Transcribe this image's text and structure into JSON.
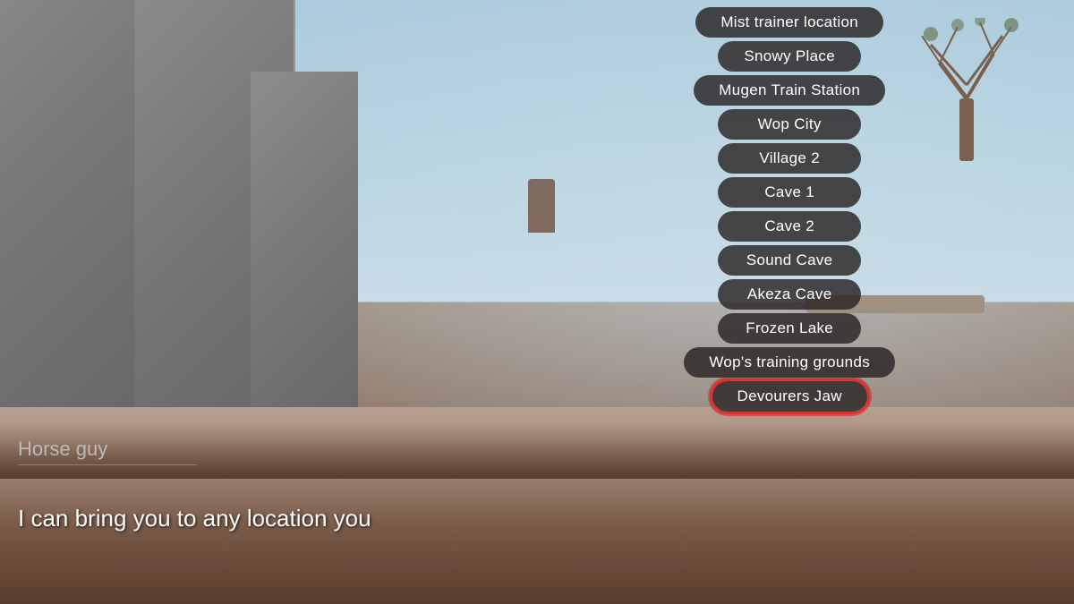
{
  "scene": {
    "npc_name": "Horse guy",
    "npc_dialogue": "I can bring you to any location you"
  },
  "location_menu": {
    "items": [
      {
        "id": "mist-trainer-location",
        "label": "Mist trainer location",
        "selected": false
      },
      {
        "id": "snowy-place",
        "label": "Snowy Place",
        "selected": false
      },
      {
        "id": "mugen-train-station",
        "label": "Mugen Train Station",
        "selected": false
      },
      {
        "id": "wop-city",
        "label": "Wop City",
        "selected": false
      },
      {
        "id": "village-2",
        "label": "Village 2",
        "selected": false
      },
      {
        "id": "cave-1",
        "label": "Cave 1",
        "selected": false
      },
      {
        "id": "cave-2",
        "label": "Cave 2",
        "selected": false
      },
      {
        "id": "sound-cave",
        "label": "Sound Cave",
        "selected": false
      },
      {
        "id": "akeza-cave",
        "label": "Akeza Cave",
        "selected": false
      },
      {
        "id": "frozen-lake",
        "label": "Frozen Lake",
        "selected": false
      },
      {
        "id": "wons-training-grounds",
        "label": "Wop's training grounds",
        "selected": false
      },
      {
        "id": "devourers-jaw",
        "label": "Devourers Jaw",
        "selected": true
      }
    ]
  }
}
